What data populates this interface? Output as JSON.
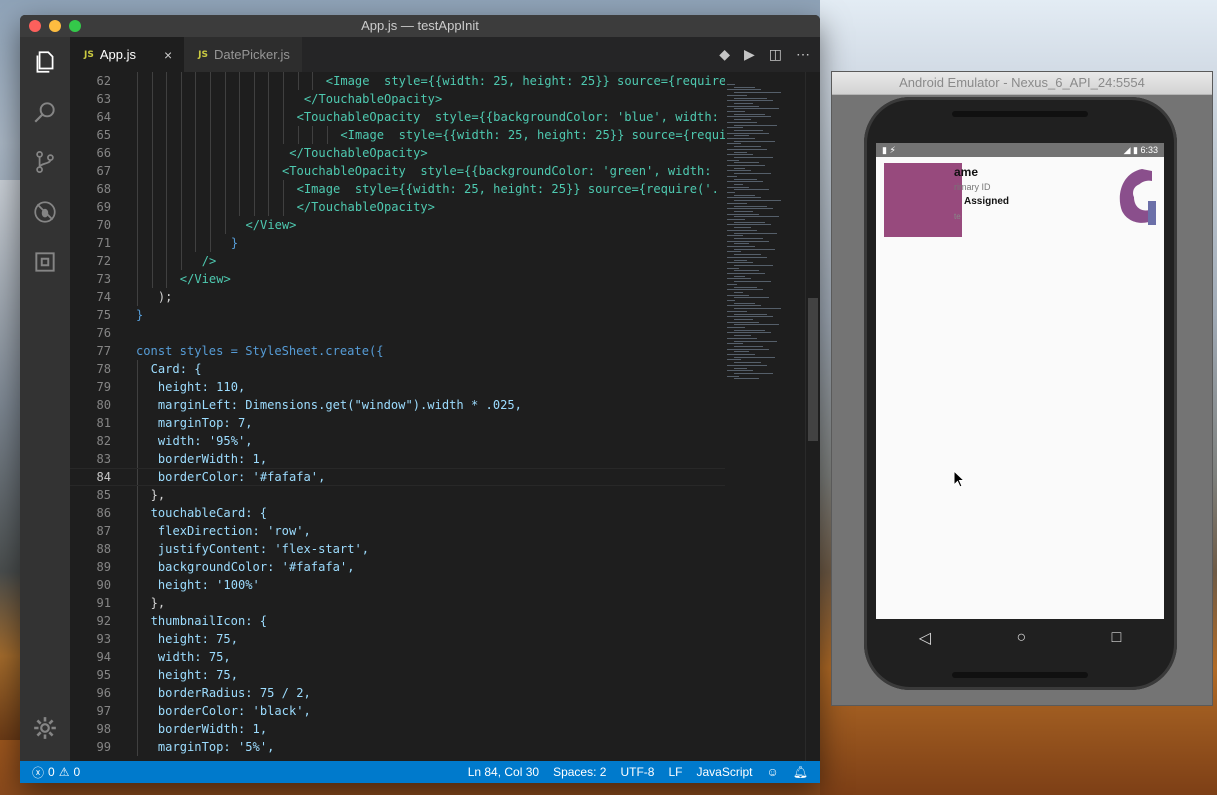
{
  "window": {
    "title": "App.js — testAppInit"
  },
  "tabs": [
    {
      "icon": "JS",
      "label": "App.js",
      "close": "×"
    },
    {
      "icon": "JS",
      "label": "DatePicker.js"
    }
  ],
  "editor": {
    "lines": [
      {
        "n": "62",
        "text": "<Image  style={{width: 25, height: 25}} source={require"
      },
      {
        "n": "63",
        "text": "</TouchableOpacity>"
      },
      {
        "n": "64",
        "text": "<TouchableOpacity  style={{backgroundColor: 'blue', width:"
      },
      {
        "n": "65",
        "text": "<Image  style={{width: 25, height: 25}} source={requi"
      },
      {
        "n": "66",
        "text": "</TouchableOpacity>"
      },
      {
        "n": "67",
        "text": "<TouchableOpacity  style={{backgroundColor: 'green', width:"
      },
      {
        "n": "68",
        "text": "<Image  style={{width: 25, height: 25}} source={require('."
      },
      {
        "n": "69",
        "text": "</TouchableOpacity>"
      },
      {
        "n": "70",
        "text": "</View>"
      },
      {
        "n": "71",
        "text": "}"
      },
      {
        "n": "72",
        "text": "/>"
      },
      {
        "n": "73",
        "text": "</View>"
      },
      {
        "n": "74",
        "text": ");"
      },
      {
        "n": "75",
        "text": "}"
      },
      {
        "n": "76",
        "text": ""
      },
      {
        "n": "77",
        "text": "const styles = StyleSheet.create({"
      },
      {
        "n": "78",
        "text": "Card: {"
      },
      {
        "n": "79",
        "text": "height: 110,"
      },
      {
        "n": "80",
        "text": "marginLeft: Dimensions.get(\"window\").width * .025,"
      },
      {
        "n": "81",
        "text": "marginTop: 7,"
      },
      {
        "n": "82",
        "text": "width: '95%',"
      },
      {
        "n": "83",
        "text": "borderWidth: 1,"
      },
      {
        "n": "84",
        "text": "borderColor: '#fafafa',"
      },
      {
        "n": "85",
        "text": "},"
      },
      {
        "n": "86",
        "text": "touchableCard: {"
      },
      {
        "n": "87",
        "text": "flexDirection: 'row',"
      },
      {
        "n": "88",
        "text": "justifyContent: 'flex-start',"
      },
      {
        "n": "89",
        "text": "backgroundColor: '#fafafa',"
      },
      {
        "n": "90",
        "text": "height: '100%'"
      },
      {
        "n": "91",
        "text": "},"
      },
      {
        "n": "92",
        "text": "thumbnailIcon: {"
      },
      {
        "n": "93",
        "text": "height: 75,"
      },
      {
        "n": "94",
        "text": "width: 75,"
      },
      {
        "n": "95",
        "text": "height: 75,"
      },
      {
        "n": "96",
        "text": "borderRadius: 75 / 2,"
      },
      {
        "n": "97",
        "text": "borderColor: 'black',"
      },
      {
        "n": "98",
        "text": "borderWidth: 1,"
      },
      {
        "n": "99",
        "text": "marginTop: '5%',"
      }
    ]
  },
  "statusbar": {
    "errors": "0",
    "warnings": "0",
    "position": "Ln 84, Col 30",
    "spaces": "Spaces: 2",
    "encoding": "UTF-8",
    "eol": "LF",
    "language": "JavaScript"
  },
  "emulator": {
    "title": "Android Emulator - Nexus_6_API_24:5554",
    "time": "6:33",
    "card": {
      "name": "ame",
      "subtitle": "rimary ID",
      "status": "Assigned",
      "date": "te"
    }
  },
  "colors": {
    "statusbar": "#007acc",
    "thumbnail": "#974a7d",
    "editor_bg": "#1e1e1e"
  },
  "icons": [
    "files-icon",
    "search-icon",
    "source-control-icon",
    "debug-icon",
    "extensions-icon",
    "gear-icon",
    "git-compare-icon",
    "run-icon",
    "split-editor-icon",
    "more-icon",
    "error-icon",
    "warning-icon",
    "smiley-icon",
    "bell-icon",
    "back-icon",
    "home-icon",
    "recents-icon",
    "cursor-icon"
  ]
}
